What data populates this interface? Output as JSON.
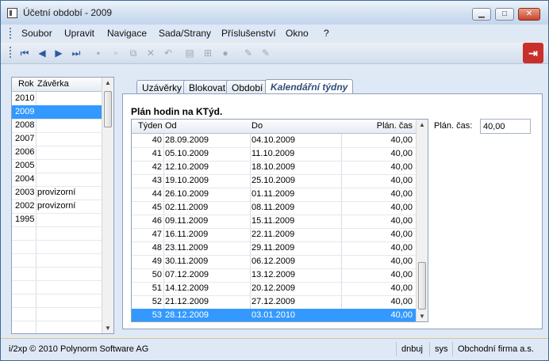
{
  "window": {
    "title": "Účetní období - 2009"
  },
  "menu": [
    "Soubor",
    "Upravit",
    "Navigace",
    "Sada/Strany",
    "Příslušenství",
    "Okno",
    "?"
  ],
  "toolbar_icons": [
    "first-icon",
    "prev-icon",
    "next-icon",
    "last-icon",
    "save-icon",
    "new-icon",
    "copy-icon",
    "delete-icon",
    "undo-icon",
    "print-icon",
    "tree-icon",
    "refresh-icon",
    "edit-icon",
    "edit2-icon"
  ],
  "years_list": {
    "headers": {
      "year": "Rok",
      "closing": "Závěrka"
    },
    "rows": [
      {
        "year": "2010",
        "closing": ""
      },
      {
        "year": "2009",
        "closing": "",
        "selected": true
      },
      {
        "year": "2008",
        "closing": ""
      },
      {
        "year": "2007",
        "closing": ""
      },
      {
        "year": "2006",
        "closing": ""
      },
      {
        "year": "2005",
        "closing": ""
      },
      {
        "year": "2004",
        "closing": ""
      },
      {
        "year": "2003",
        "closing": "provizorní"
      },
      {
        "year": "2002",
        "closing": "provizorní"
      },
      {
        "year": "1995",
        "closing": ""
      }
    ]
  },
  "tabs": [
    {
      "label": "Uzávěrky"
    },
    {
      "label": "Blokovat"
    },
    {
      "label": "Období"
    },
    {
      "label": "Kalendářní týdny",
      "active": true
    }
  ],
  "panel": {
    "section_title": "Plán hodin na KTýd.",
    "plan_label": "Plán. čas:",
    "plan_value": "40,00"
  },
  "weeks_table": {
    "headers": {
      "week": "Týden",
      "from": "Od",
      "to": "Do",
      "plan": "Plán. čas"
    },
    "rows": [
      {
        "week": "40",
        "from": "28.09.2009",
        "to": "04.10.2009",
        "plan": "40,00"
      },
      {
        "week": "41",
        "from": "05.10.2009",
        "to": "11.10.2009",
        "plan": "40,00"
      },
      {
        "week": "42",
        "from": "12.10.2009",
        "to": "18.10.2009",
        "plan": "40,00"
      },
      {
        "week": "43",
        "from": "19.10.2009",
        "to": "25.10.2009",
        "plan": "40,00"
      },
      {
        "week": "44",
        "from": "26.10.2009",
        "to": "01.11.2009",
        "plan": "40,00"
      },
      {
        "week": "45",
        "from": "02.11.2009",
        "to": "08.11.2009",
        "plan": "40,00"
      },
      {
        "week": "46",
        "from": "09.11.2009",
        "to": "15.11.2009",
        "plan": "40,00"
      },
      {
        "week": "47",
        "from": "16.11.2009",
        "to": "22.11.2009",
        "plan": "40,00"
      },
      {
        "week": "48",
        "from": "23.11.2009",
        "to": "29.11.2009",
        "plan": "40,00"
      },
      {
        "week": "49",
        "from": "30.11.2009",
        "to": "06.12.2009",
        "plan": "40,00"
      },
      {
        "week": "50",
        "from": "07.12.2009",
        "to": "13.12.2009",
        "plan": "40,00"
      },
      {
        "week": "51",
        "from": "14.12.2009",
        "to": "20.12.2009",
        "plan": "40,00"
      },
      {
        "week": "52",
        "from": "21.12.2009",
        "to": "27.12.2009",
        "plan": "40,00"
      },
      {
        "week": "53",
        "from": "28.12.2009",
        "to": "03.01.2010",
        "plan": "40,00",
        "selected": true
      }
    ]
  },
  "status": {
    "copyright": "i/2xp © 2010 Polynorm Software AG",
    "user": "dnbuj",
    "system": "sys",
    "company": "Obchodní firma a.s."
  }
}
